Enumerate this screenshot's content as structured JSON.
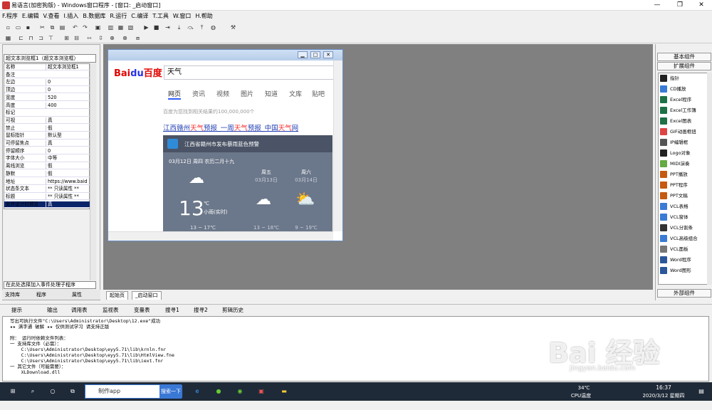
{
  "window": {
    "title": "易语言(加密狗版) - Windows窗口程序 - [窗口: _启动窗口]"
  },
  "menu": [
    "F.程序",
    "E.编辑",
    "V.查看",
    "I.插入",
    "B.数据库",
    "R.运行",
    "C.编译",
    "T.工具",
    "W.窗口",
    "H.帮助"
  ],
  "left": {
    "object_select": "超文本浏览框1（超文本浏览框）",
    "properties": [
      {
        "name": "名称",
        "value": "超文本浏览框1"
      },
      {
        "name": "备注",
        "value": ""
      },
      {
        "name": "左边",
        "value": "0"
      },
      {
        "name": "顶边",
        "value": "0"
      },
      {
        "name": "宽度",
        "value": "520"
      },
      {
        "name": "高度",
        "value": "400"
      },
      {
        "name": "标记",
        "value": ""
      },
      {
        "name": "可视",
        "value": "真"
      },
      {
        "name": "禁止",
        "value": "假"
      },
      {
        "name": "鼠标指针",
        "value": "默认型"
      },
      {
        "name": "可停留焦点",
        "value": "真"
      },
      {
        "name": "停留顺序",
        "value": "0"
      },
      {
        "name": "字体大小",
        "value": "中等"
      },
      {
        "name": "离线浏览",
        "value": "假"
      },
      {
        "name": "静默",
        "value": "假"
      },
      {
        "name": "地址",
        "value": "https://www.baid"
      },
      {
        "name": "状态条文本",
        "value": "** 只读属性 **"
      },
      {
        "name": "标题",
        "value": "** 只读属性 **"
      },
      {
        "name": "允许设计时预览",
        "value": "真"
      }
    ],
    "event_select": "在此处选择加入事件处理子程序",
    "tabs": [
      "支持库",
      "程序",
      "属性"
    ]
  },
  "baidu": {
    "logo_a": "Bai",
    "logo_b": "du",
    "logo_c": "百度",
    "query": "天气",
    "tabs": [
      "网页",
      "资讯",
      "视频",
      "图片",
      "知道",
      "文库",
      "贴吧"
    ],
    "result_count": "百度为您找到相关结果约100,000,000个",
    "result_title_parts": [
      "江西赣州",
      "天气",
      "预报_一周",
      "天气",
      "预报_中国",
      "天气",
      "网"
    ],
    "weather": {
      "alert": "江西省赣州市发布暴雨蓝色预警",
      "date": "03月12日 周四 农历二月十九",
      "temp": "13",
      "unit": "℃",
      "condition": "小雨(实时)",
      "range_today": "13 ~ 17℃",
      "days": [
        {
          "name": "周五",
          "date": "03月13日",
          "range": "13 ~ 18℃"
        },
        {
          "name": "周六",
          "date": "03月14日",
          "range": "9 ~ 19℃"
        }
      ]
    }
  },
  "canvas_tabs": [
    "起始页",
    "_启动窗口"
  ],
  "right": {
    "btn_basic": "基本组件",
    "btn_ext": "扩展组件",
    "btn_external": "外部组件",
    "components": [
      {
        "label": "指针",
        "color": "#222"
      },
      {
        "label": "CD播放",
        "color": "#3a7bd5"
      },
      {
        "label": "Excel程序",
        "color": "#1e7145"
      },
      {
        "label": "Excel工作簿",
        "color": "#1e7145"
      },
      {
        "label": "Excel图表",
        "color": "#1e7145"
      },
      {
        "label": "GIF动画框扭",
        "color": "#d44"
      },
      {
        "label": "IP编辑框",
        "color": "#555"
      },
      {
        "label": "Logo对象",
        "color": "#222"
      },
      {
        "label": "MIDI演奏",
        "color": "#6a4"
      },
      {
        "label": "PPT播放",
        "color": "#c55a11"
      },
      {
        "label": "PPT程序",
        "color": "#c55a11"
      },
      {
        "label": "PPT文稿",
        "color": "#c55a11"
      },
      {
        "label": "VCL表格",
        "color": "#3a7bd5"
      },
      {
        "label": "VCL窗体",
        "color": "#3a7bd5"
      },
      {
        "label": "VCL分割条",
        "color": "#333"
      },
      {
        "label": "VCL高级组合",
        "color": "#3a7bd5"
      },
      {
        "label": "VCL面板",
        "color": "#777"
      },
      {
        "label": "Word程序",
        "color": "#2b579a"
      },
      {
        "label": "Word图形",
        "color": "#2b579a"
      }
    ]
  },
  "output_tabs": [
    "提示",
    "输出",
    "调用表",
    "监视表",
    "变量表",
    "搜寻1",
    "搜寻2",
    "剪辑历史"
  ],
  "output_lines": [
    "写出可执行文件\"C:\\Users\\Administrator\\Desktop\\12.exe\"成功",
    "★★ 满字通 破解 ★★ 仅供测试学习 请支持正版",
    "",
    "附： 运行时依赖文件列表：",
    "一 支持库文件（必需）：",
    "    C:\\Users\\Administrator\\Desktop\\eyy5.71\\lib\\krnln.fnr",
    "    C:\\Users\\Administrator\\Desktop\\eyy5.71\\lib\\HtmlView.fne",
    "    C:\\Users\\Administrator\\Desktop\\eyy5.71\\lib\\iext.fnr",
    "一 其它文件（可能需要）：",
    "    XLDownload.dll"
  ],
  "watermark": {
    "main": "Bai 经验",
    "sub": "jingyan.baidu.com"
  },
  "taskbar": {
    "search_text": "制作app",
    "search_button": "搜索一下",
    "temp": "34℃",
    "cpu": "CPU温度",
    "time": "16:37",
    "date": "2020/3/12 星期四"
  }
}
